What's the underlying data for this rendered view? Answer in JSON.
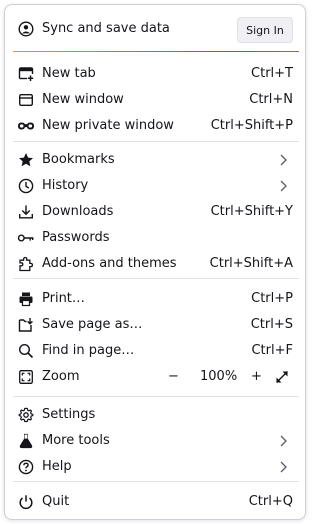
{
  "header": {
    "sync_label": "Sync and save data",
    "sign_in_label": "Sign In",
    "icon": "account-icon",
    "gradient": [
      "#e09b20",
      "#e14e78",
      "#8a3bd6",
      "#7a5cf0"
    ]
  },
  "groups": [
    [
      {
        "label": "New tab",
        "shortcut": "Ctrl+T",
        "icon": "new-tab-icon"
      },
      {
        "label": "New window",
        "shortcut": "Ctrl+N",
        "icon": "new-window-icon"
      },
      {
        "label": "New private window",
        "shortcut": "Ctrl+Shift+P",
        "icon": "private-window-icon"
      }
    ],
    [
      {
        "label": "Bookmarks",
        "icon": "star-icon",
        "submenu": true
      },
      {
        "label": "History",
        "icon": "clock-icon",
        "submenu": true
      },
      {
        "label": "Downloads",
        "shortcut": "Ctrl+Shift+Y",
        "icon": "download-icon"
      },
      {
        "label": "Passwords",
        "icon": "key-icon"
      },
      {
        "label": "Add-ons and themes",
        "shortcut": "Ctrl+Shift+A",
        "icon": "puzzle-icon"
      }
    ],
    [
      {
        "label": "Print…",
        "shortcut": "Ctrl+P",
        "icon": "print-icon"
      },
      {
        "label": "Save page as…",
        "shortcut": "Ctrl+S",
        "icon": "save-icon"
      },
      {
        "label": "Find in page…",
        "shortcut": "Ctrl+F",
        "icon": "search-icon"
      }
    ]
  ],
  "zoom": {
    "label": "Zoom",
    "minus": "−",
    "value": "100%",
    "plus": "+",
    "icon": "zoom-icon",
    "fullscreen_icon": "fullscreen-icon"
  },
  "tools": [
    {
      "label": "Settings",
      "icon": "gear-icon"
    },
    {
      "label": "More tools",
      "icon": "flask-icon",
      "submenu": true
    },
    {
      "label": "Help",
      "icon": "help-icon",
      "submenu": true
    }
  ],
  "quit": {
    "label": "Quit",
    "shortcut": "Ctrl+Q",
    "icon": "power-icon"
  }
}
